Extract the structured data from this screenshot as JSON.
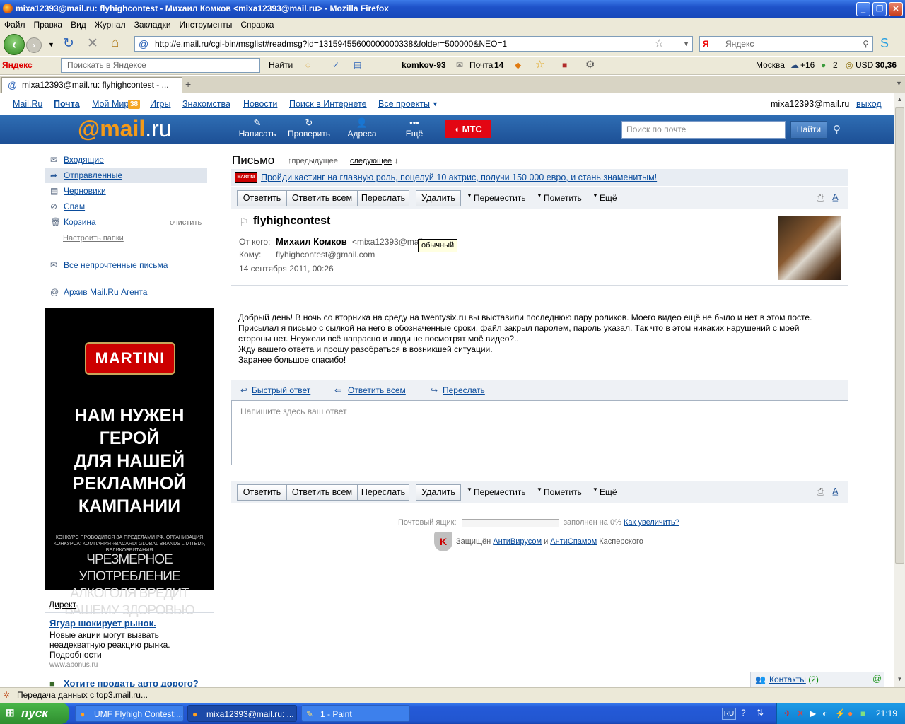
{
  "window": {
    "title": "mixa12393@mail.ru: flyhighcontest - Михаил Комков <mixa12393@mail.ru> - Mozilla Firefox"
  },
  "menu": [
    "Файл",
    "Правка",
    "Вид",
    "Журнал",
    "Закладки",
    "Инструменты",
    "Справка"
  ],
  "browser": {
    "url": "http://e.mail.ru/cgi-bin/msglist#readmsg?id=13159455600000000338&folder=500000&NEO=1",
    "search_placeholder": "Яндекс"
  },
  "yandex_bar": {
    "logo": "Яндекс",
    "search_placeholder": "Поискать в Яндексе",
    "find": "Найти",
    "user": "komkov-93",
    "mail_label": "Почта",
    "mail_count": "14",
    "city": "Москва",
    "temp": "+16",
    "count2": "2",
    "currency": "USD",
    "rate": "30,36"
  },
  "tab": {
    "title": "mixa12393@mail.ru: flyhighcontest - ..."
  },
  "topnav": {
    "items": [
      "Mail.Ru",
      "Почта",
      "Мой Мир",
      "Игры",
      "Знакомства",
      "Новости",
      "Поиск в Интернете",
      "Все проекты"
    ],
    "mymir_badge": "38",
    "user": "mixa12393@mail.ru",
    "logout": "выход"
  },
  "header": {
    "logo_at": "@mail",
    "logo_ru": ".ru",
    "tools": [
      "Написать",
      "Проверить",
      "Адреса",
      "Ещё"
    ],
    "mts": "МТС",
    "search_placeholder": "Поиск по почте",
    "search_btn": "Найти"
  },
  "sidebar": {
    "folders": [
      "Входящие",
      "Отправленные",
      "Черновики",
      "Спам",
      "Корзина"
    ],
    "clear": "очистить",
    "configure": "Настроить папки",
    "unread": "Все непрочтенные письма",
    "archive": "Архив Mail.Ru Агента",
    "banner": {
      "brand": "MARTINI",
      "lines": [
        "НАМ НУЖЕН",
        "ГЕРОЙ",
        "ДЛЯ НАШЕЙ",
        "РЕКЛАМНОЙ",
        "КАМПАНИИ"
      ],
      "fine": "КОНКУРС ПРОВОДИТСЯ ЗА ПРЕДЕЛАМИ РФ. ОРГАНИЗАЦИЯ КОНКУРСА: КОМПАНИЯ «BACARDI GLOBAL BRANDS LIMITED», ВЕЛИКОБРИТАНИЯ",
      "warning": "ЧРЕЗМЕРНОЕ УПОТРЕБЛЕНИЕ АЛКОГОЛЯ ВРЕДИТ ВАШЕМУ ЗДОРОВЬЮ"
    },
    "direct": {
      "label": "Директ",
      "ad1_title": "Ягуар шокирует рынок.",
      "ad1_text": "Новые акции могут вызвать неадекватную реакцию рынка. Подробности",
      "ad1_url": "www.abonus.ru",
      "ad2_title": "Хотите продать авто дорого?"
    }
  },
  "letter": {
    "title": "Письмо",
    "prev": "предыдущее",
    "next": "следующее",
    "ad": "Пройди кастинг на главную роль, поцелуй 10 актрис, получи 150 000 евро, и стань знаменитым!",
    "ad_logo": "MARTINI",
    "toolbar": {
      "reply": "Ответить",
      "reply_all": "Ответить всем",
      "forward": "Переслать",
      "delete": "Удалить",
      "move": "Переместить",
      "mark": "Пометить",
      "more": "Ещё"
    },
    "subject": "flyhighcontest",
    "from_label": "От кого:",
    "from_name": "Михаил Комков",
    "from_email": "<mixa12393@mail.ru>",
    "to_label": "Кому:",
    "to": "flyhighcontest@gmail.com",
    "date": "14 сентября 2011, 00:26",
    "tooltip": "обычный",
    "body": [
      "Добрый день! В ночь со вторника на среду на twentysix.ru вы выставили последнюю пару роликов. Моего видео ещё не было и нет в этом посте.",
      "Присылал я письмо с сылкой на него в обозначенные сроки, файл закрыл паролем, пароль указал. Так что в этом никаких нарушений с моей стороны нет. Неужели всё напрасно и люди не посмотрят моё видео?..",
      "Жду вашего ответа и прошу разобраться в возникшей ситуации.",
      "Заранее большое спасибо!"
    ],
    "quick_reply": "Быстрый ответ",
    "quick_reply_all": "Ответить всем",
    "quick_forward": "Переслать",
    "reply_placeholder": "Напишите здесь ваш ответ"
  },
  "footer": {
    "mailbox_label": "Почтовый ящик:",
    "filled": "заполнен на 0%",
    "increase": "Как увеличить?",
    "protected": "Защищён",
    "antivirus": "АнтиВирусом",
    "and": "и",
    "antispam": "АнтиСпамом",
    "kaspersky": "Касперского"
  },
  "contacts": {
    "label": "Контакты",
    "count": "(2)"
  },
  "statusbar": "Передача данных с top3.mail.ru...",
  "taskbar": {
    "start": "пуск",
    "tasks": [
      "UMF Flyhigh Contest:...",
      "mixa12393@mail.ru: ...",
      "1 - Paint"
    ],
    "lang": "RU",
    "clock": "21:19"
  }
}
